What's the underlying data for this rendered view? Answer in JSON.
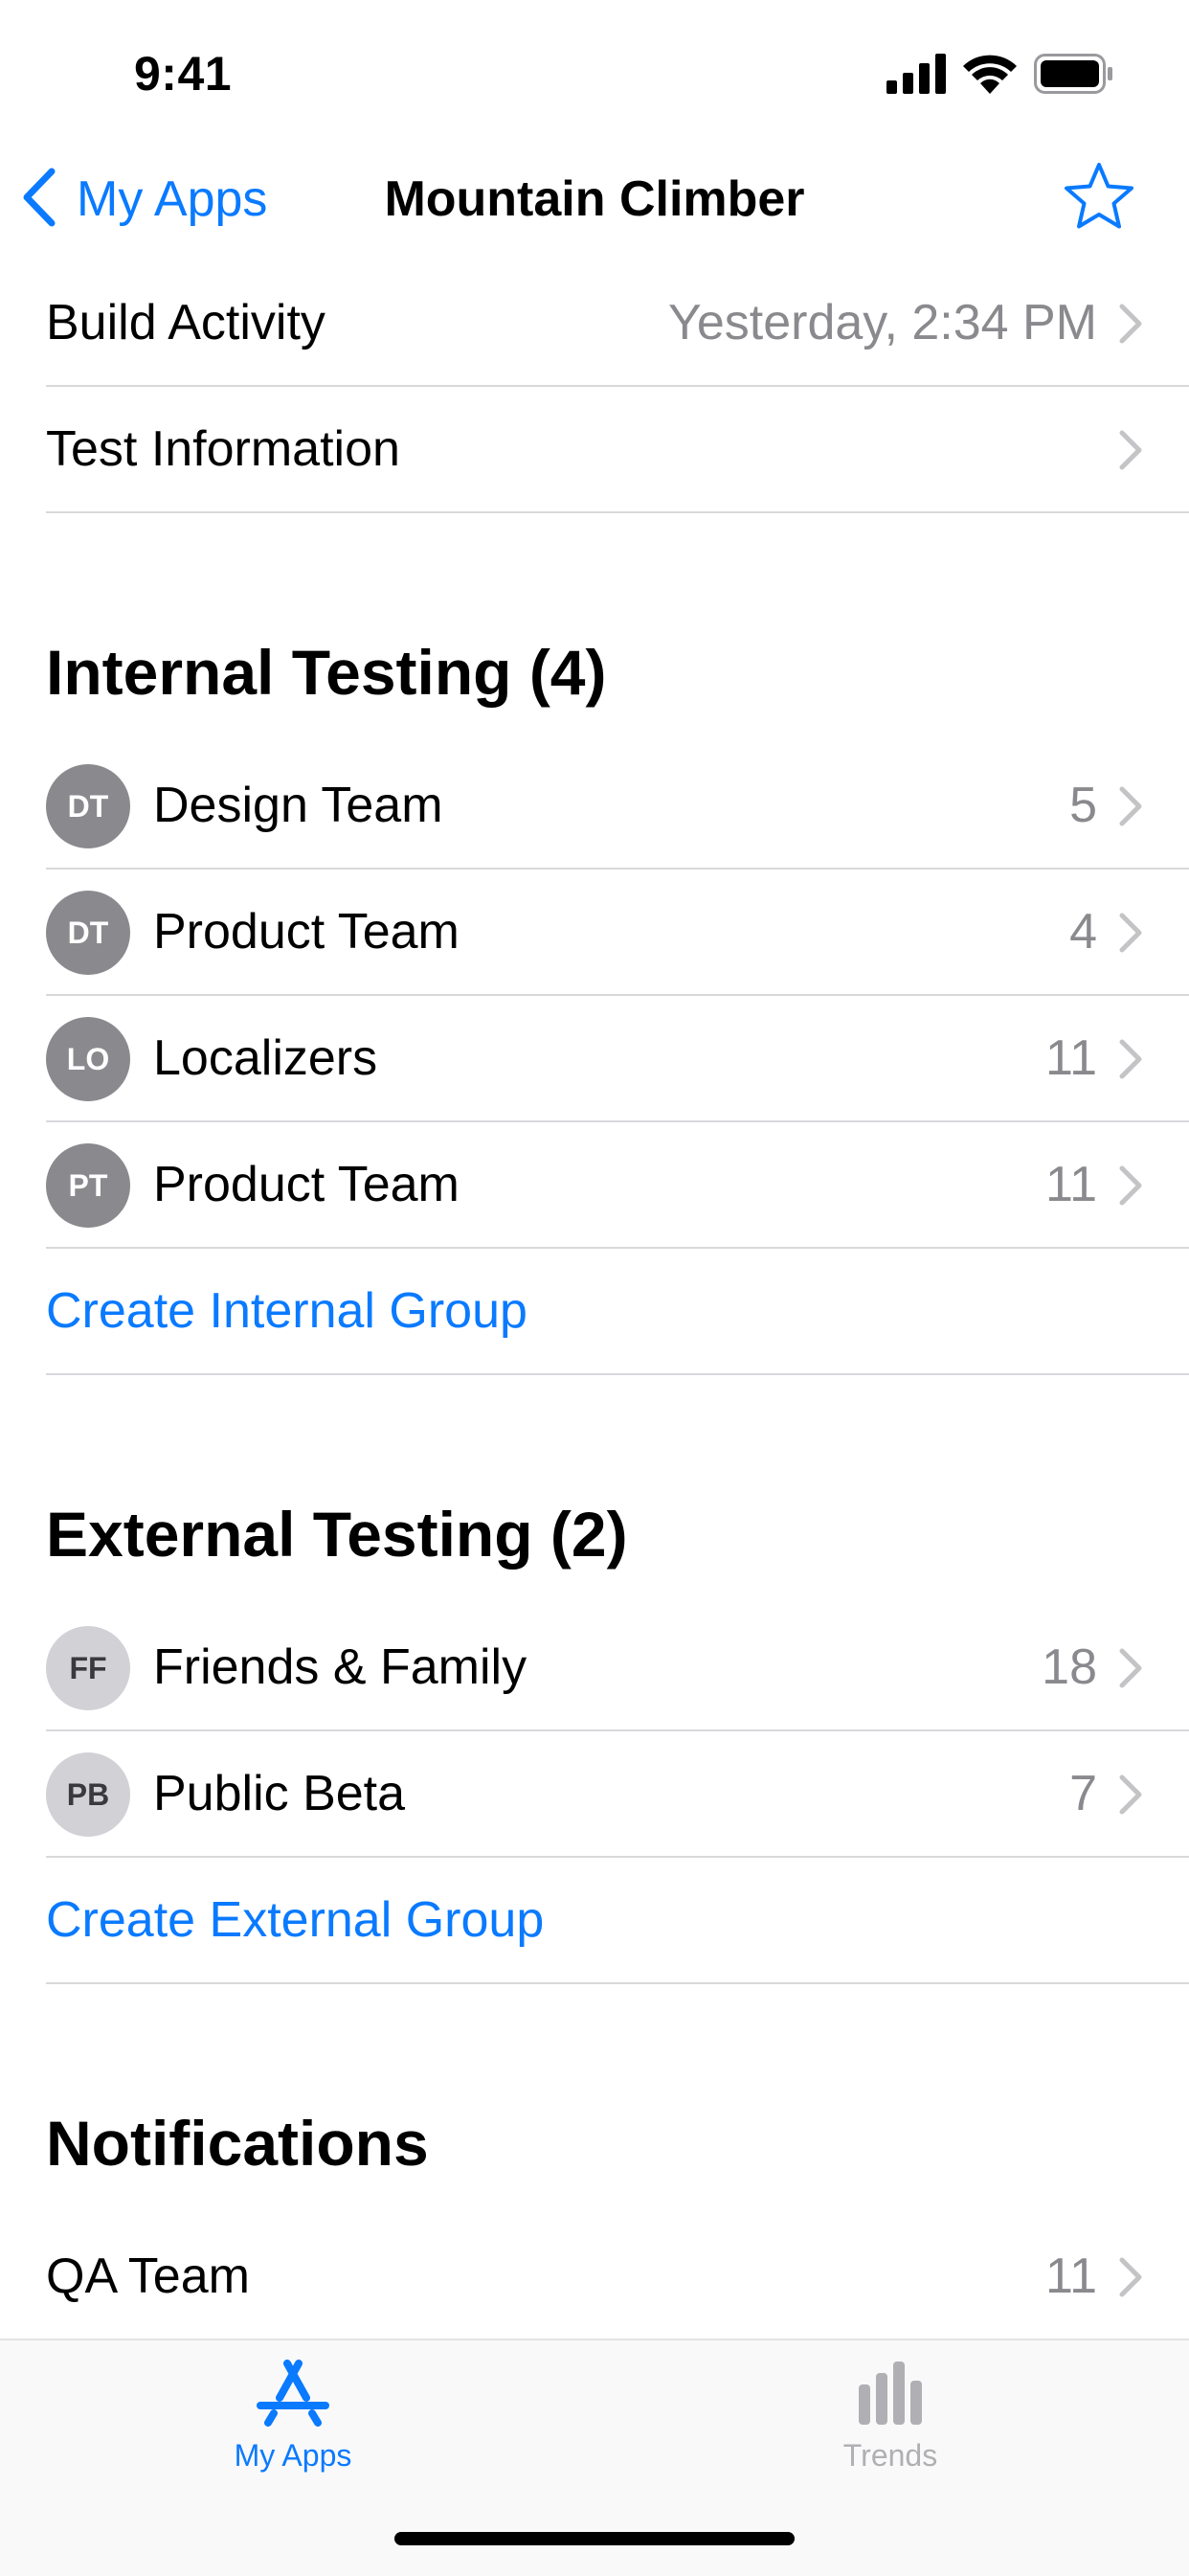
{
  "status_bar": {
    "time": "9:41"
  },
  "nav": {
    "back_label": "My Apps",
    "title": "Mountain Climber"
  },
  "info_rows": [
    {
      "label": "Build Activity",
      "value": "Yesterday, 2:34 PM"
    },
    {
      "label": "Test Information",
      "value": ""
    }
  ],
  "internal_testing": {
    "title": "Internal Testing (4)",
    "groups": [
      {
        "initials": "DT",
        "name": "Design Team",
        "count": "5"
      },
      {
        "initials": "DT",
        "name": "Product Team",
        "count": "4"
      },
      {
        "initials": "LO",
        "name": "Localizers",
        "count": "11"
      },
      {
        "initials": "PT",
        "name": "Product Team",
        "count": "11"
      }
    ],
    "create_label": "Create Internal Group"
  },
  "external_testing": {
    "title": "External Testing (2)",
    "groups": [
      {
        "initials": "FF",
        "name": "Friends & Family",
        "count": "18"
      },
      {
        "initials": "PB",
        "name": "Public Beta",
        "count": "7"
      }
    ],
    "create_label": "Create External Group"
  },
  "notifications": {
    "title": "Notifications",
    "rows": [
      {
        "name": "QA Team",
        "count": "11"
      }
    ]
  },
  "tab_bar": {
    "tabs": [
      {
        "label": "My Apps",
        "icon": "app-store-icon",
        "active": true
      },
      {
        "label": "Trends",
        "icon": "bar-chart-icon",
        "active": false
      }
    ]
  },
  "colors": {
    "accent": "#0a7aff",
    "secondary_text": "#8a8a8e",
    "inactive_tab": "#b0b0b4"
  }
}
